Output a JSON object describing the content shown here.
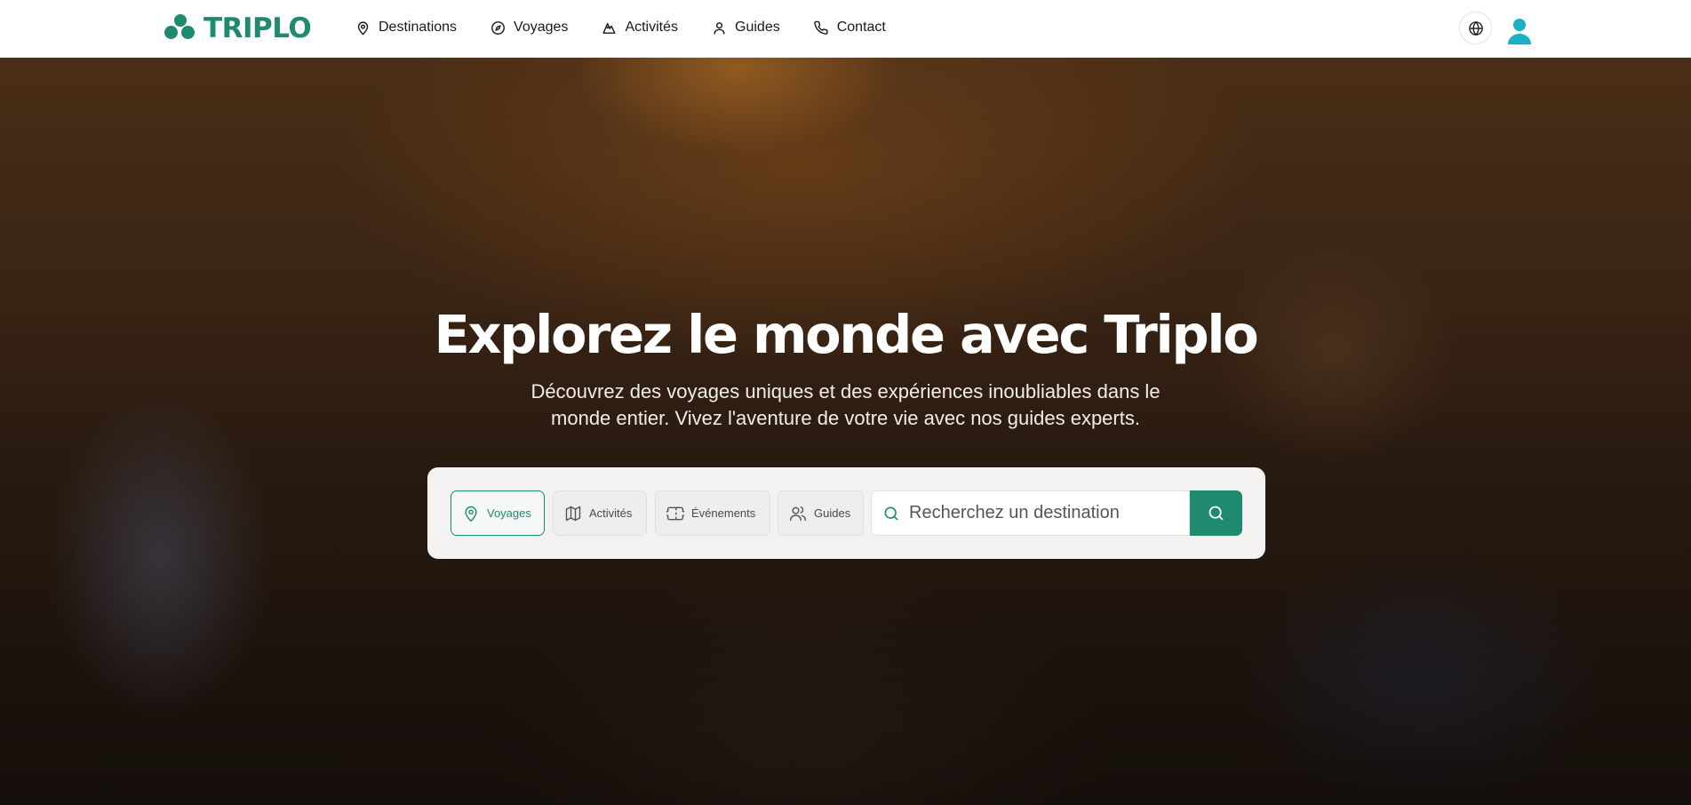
{
  "brand": {
    "name": "TRIPLO",
    "color": "#1f8a70",
    "accent": "#1cb0c8"
  },
  "nav": {
    "items": [
      {
        "label": "Destinations",
        "icon": "map-pin-icon"
      },
      {
        "label": "Voyages",
        "icon": "compass-icon"
      },
      {
        "label": "Activités",
        "icon": "mountain-icon"
      },
      {
        "label": "Guides",
        "icon": "user-icon"
      },
      {
        "label": "Contact",
        "icon": "phone-icon"
      }
    ]
  },
  "header_actions": {
    "language_icon": "globe-icon",
    "account_icon": "user-avatar-icon"
  },
  "hero": {
    "title": "Explorez le monde avec Triplo",
    "subtitle": "Découvrez des voyages uniques et des expériences inoubliables dans le monde entier. Vivez l'aventure de votre vie avec nos guides experts."
  },
  "search": {
    "tabs": [
      {
        "label": "Voyages",
        "icon": "map-pin-icon",
        "active": true
      },
      {
        "label": "Activités",
        "icon": "map-icon",
        "active": false
      },
      {
        "label": "Événements",
        "icon": "ticket-icon",
        "active": false
      },
      {
        "label": "Guides",
        "icon": "users-icon",
        "active": false
      }
    ],
    "placeholder": "Recherchez un destination",
    "button_icon": "search-icon"
  }
}
